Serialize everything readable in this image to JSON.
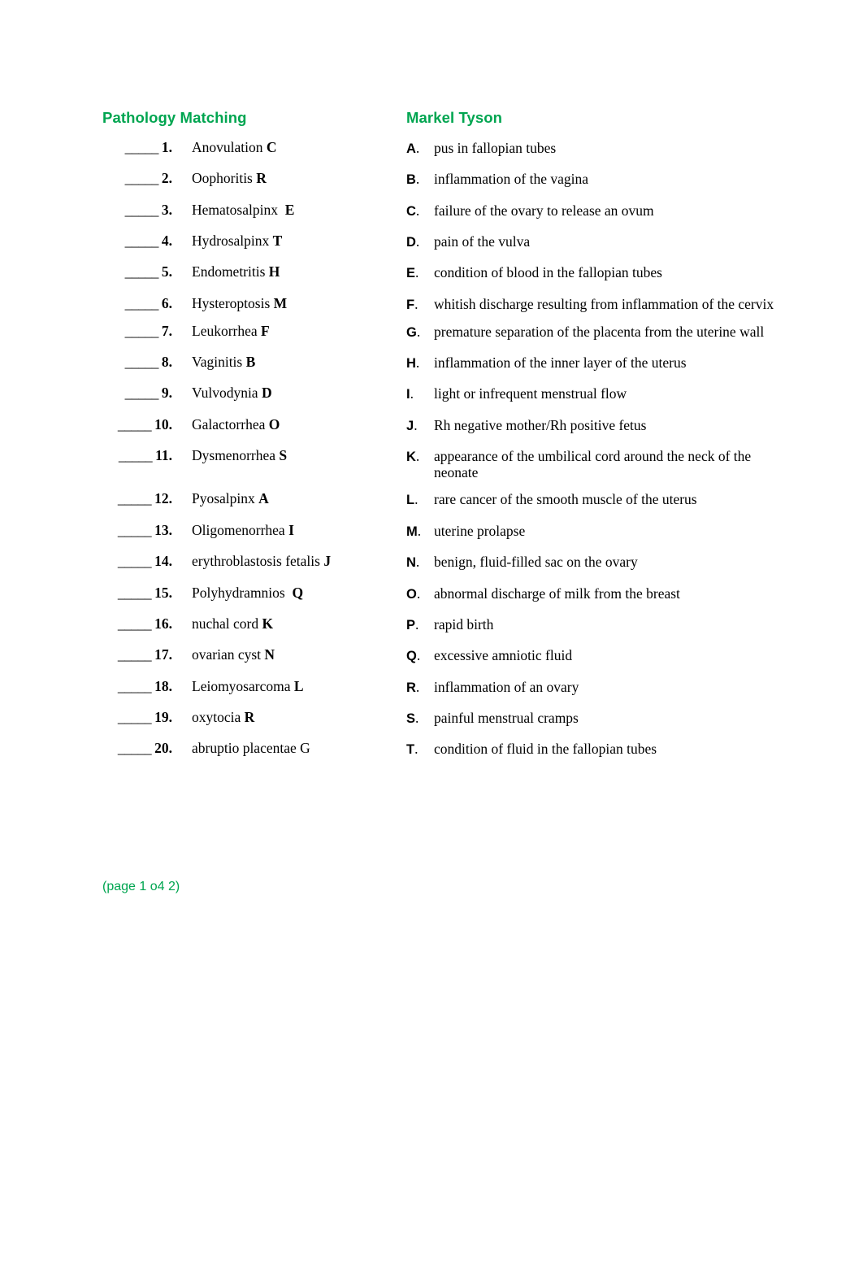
{
  "document": {
    "title_left": "Pathology Matching",
    "title_right": "Markel Tyson",
    "footer": "(page 1 o4 2)",
    "accent_color": "#00a550",
    "text_color": "#000000",
    "background_color": "#ffffff",
    "blank_line": "_____"
  },
  "terms": [
    {
      "number": "1.",
      "term": "Anovulation ",
      "answer": "C",
      "answer_bold": true
    },
    {
      "number": "2.",
      "term": "Oophoritis ",
      "answer": "R",
      "answer_bold": true
    },
    {
      "number": "3.",
      "term": "Hematosalpinx  ",
      "answer": "E",
      "answer_bold": true
    },
    {
      "number": "4.",
      "term": "Hydrosalpinx ",
      "answer": "T",
      "answer_bold": true
    },
    {
      "number": "5.",
      "term": "Endometritis ",
      "answer": "H",
      "answer_bold": true
    },
    {
      "number": "6.",
      "term": "Hysteroptosis ",
      "answer": "M",
      "answer_bold": true
    },
    {
      "number": "7.",
      "term": "Leukorrhea ",
      "answer": "F",
      "answer_bold": true
    },
    {
      "number": "8.",
      "term": "Vaginitis ",
      "answer": "B",
      "answer_bold": true
    },
    {
      "number": "9.",
      "term": "Vulvodynia ",
      "answer": "D",
      "answer_bold": true
    },
    {
      "number": "10.",
      "term": "Galactorrhea ",
      "answer": "O",
      "answer_bold": true
    },
    {
      "number": "11.",
      "term": "Dysmenorrhea ",
      "answer": "S",
      "answer_bold": true
    },
    {
      "number": "12.",
      "term": "Pyosalpinx ",
      "answer": "A",
      "answer_bold": true
    },
    {
      "number": "13.",
      "term": "Oligomenorrhea ",
      "answer": "I",
      "answer_bold": true
    },
    {
      "number": "14.",
      "term": "erythroblastosis fetalis ",
      "answer": "J",
      "answer_bold": true
    },
    {
      "number": "15.",
      "term": "Polyhydramnios  ",
      "answer": "Q",
      "answer_bold": true
    },
    {
      "number": "16.",
      "term": "nuchal cord ",
      "answer": "K",
      "answer_bold": true
    },
    {
      "number": "17.",
      "term": "ovarian cyst ",
      "answer": "N",
      "answer_bold": true
    },
    {
      "number": "18.",
      "term": "Leiomyosarcoma ",
      "answer": "L",
      "answer_bold": true
    },
    {
      "number": "19.",
      "term": "oxytocia ",
      "answer": "R",
      "answer_bold": true
    },
    {
      "number": "20.",
      "term": "abruptio placentae ",
      "answer": "G",
      "answer_bold": false
    }
  ],
  "definitions": [
    {
      "letter": "A",
      "text": "pus in fallopian tubes"
    },
    {
      "letter": "B",
      "text": "inflammation of the vagina"
    },
    {
      "letter": "C",
      "text": "failure of the ovary to release an ovum"
    },
    {
      "letter": "D",
      "text": "pain of the vulva"
    },
    {
      "letter": "E",
      "text": "condition of blood in the fallopian tubes"
    },
    {
      "letter": "F",
      "text": "whitish discharge resulting from inflammation of the cervix"
    },
    {
      "letter": "G",
      "text": "premature separation of the placenta from the uterine wall"
    },
    {
      "letter": "H",
      "text": "inflammation of the inner layer of the uterus"
    },
    {
      "letter": "I",
      "text": "light or infrequent menstrual flow"
    },
    {
      "letter": "J",
      "text": "Rh negative mother/Rh positive fetus"
    },
    {
      "letter": "K",
      "text": "appearance of the umbilical cord around the neck of the neonate"
    },
    {
      "letter": "L",
      "text": "rare cancer of the smooth muscle of the uterus"
    },
    {
      "letter": "M",
      "text": "uterine prolapse"
    },
    {
      "letter": "N",
      "text": "benign, fluid-filled sac on the ovary"
    },
    {
      "letter": "O",
      "text": "abnormal discharge of milk from the breast"
    },
    {
      "letter": "P",
      "text": "rapid birth"
    },
    {
      "letter": "Q",
      "text": "excessive amniotic fluid"
    },
    {
      "letter": "R",
      "text": "inflammation of an ovary"
    },
    {
      "letter": "S",
      "text": "painful menstrual cramps"
    },
    {
      "letter": "T",
      "text": "condition of fluid in the fallopian tubes"
    }
  ]
}
